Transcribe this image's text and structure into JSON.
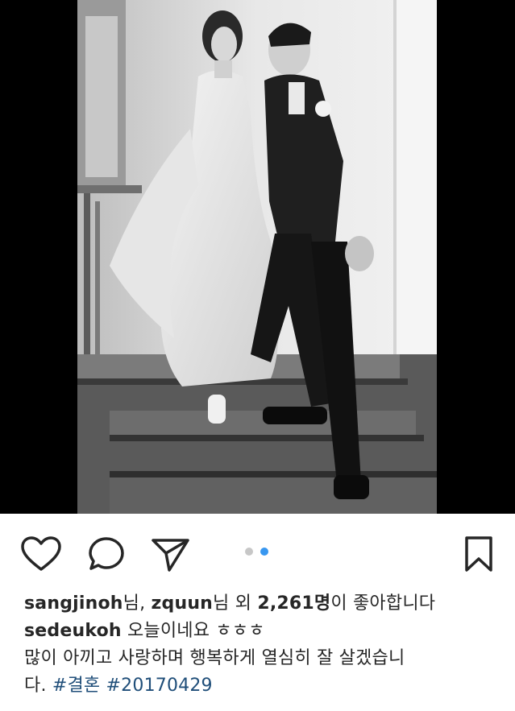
{
  "colors": {
    "background": "#ffffff",
    "frame": "#000000",
    "text": "#262626",
    "hashtag": "#1f4e79",
    "dot_active": "#3897f0",
    "dot_inactive": "#c7c7c7"
  },
  "post": {
    "photo_icon": "wedding-photo-black-and-white",
    "pager": {
      "total": 2,
      "current": 2
    }
  },
  "actions": {
    "like_icon": "heart-icon",
    "comment_icon": "comment-icon",
    "share_icon": "send-icon",
    "save_icon": "bookmark-icon"
  },
  "likes": {
    "user1": "sangjinoh",
    "sep1": "님, ",
    "user2": "zquun",
    "sep2": "님 외 ",
    "count": "2,261명",
    "suffix": "이 좋아합니다"
  },
  "caption": {
    "username": "sedeukoh",
    "text_line1": " 오늘이네요 ㅎㅎㅎ",
    "text_line2": "많이 아끼고 사랑하며 행복하게 열심히 잘 살겠습니",
    "text_line3": "다. ",
    "hashtag1": "#결혼",
    "space": " ",
    "hashtag2": "#20170429"
  }
}
